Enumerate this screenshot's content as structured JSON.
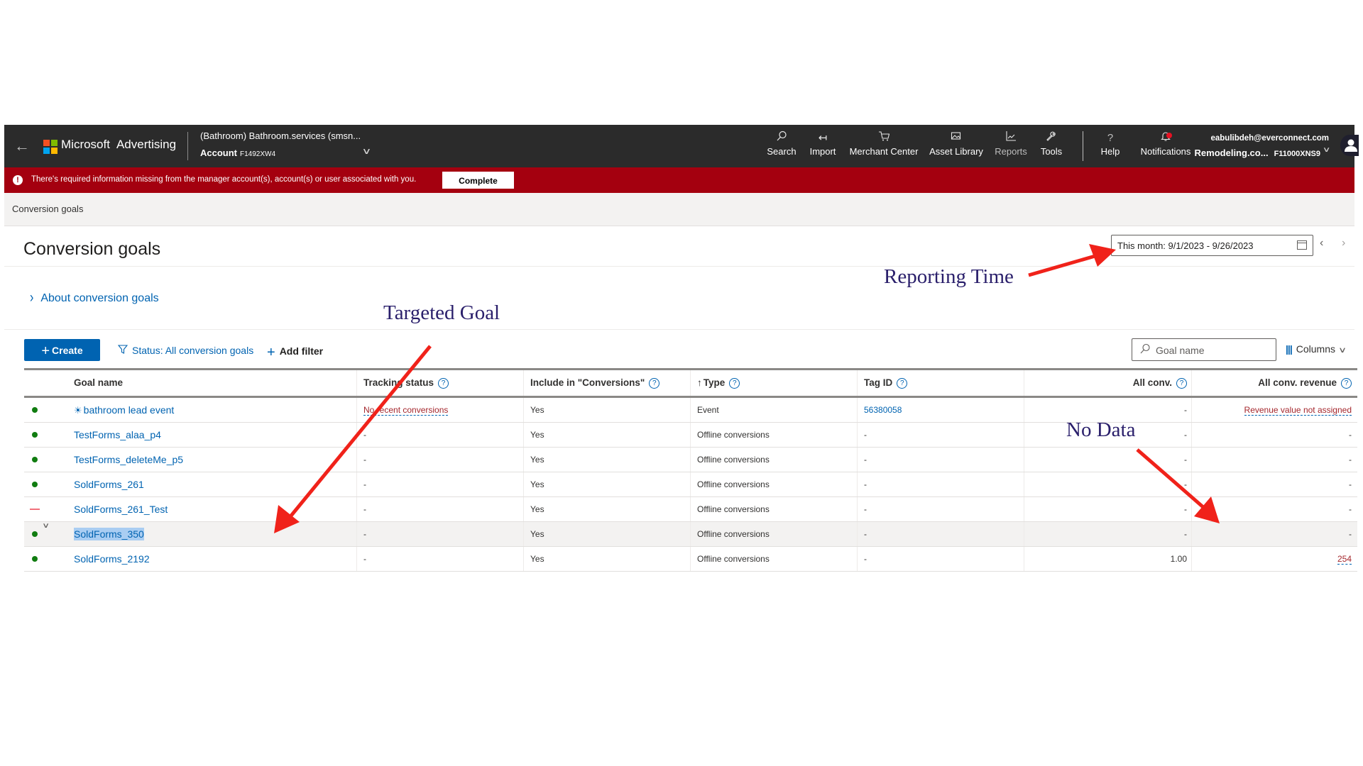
{
  "topbar": {
    "brand_name": "Microsoft",
    "brand_product": "Advertising",
    "account_name": "(Bathroom) Bathroom.services (smsn...",
    "account_label": "Account",
    "account_id": "F1492XW4",
    "nav": [
      {
        "label": "Search",
        "icon": "search-icon"
      },
      {
        "label": "Import",
        "icon": "import-icon"
      },
      {
        "label": "Merchant Center",
        "icon": "cart-icon"
      },
      {
        "label": "Asset Library",
        "icon": "asset-library-icon"
      },
      {
        "label": "Reports",
        "icon": "reports-icon"
      },
      {
        "label": "Tools",
        "icon": "wrench-icon"
      },
      {
        "label": "Help",
        "icon": "help-icon"
      },
      {
        "label": "Notifications",
        "icon": "bell-icon"
      }
    ],
    "user_email": "eabulibdeh@everconnect.com",
    "user_account": "Remodeling.co...",
    "user_account_id": "F11000XNS9"
  },
  "banner": {
    "message": "There's required information missing from the manager account(s), account(s) or user associated with you.",
    "button_label": "Complete",
    "color": "#a4000f"
  },
  "breadcrumb": "Conversion goals",
  "page": {
    "title": "Conversion goals",
    "date_range": "This month: 9/1/2023 - 9/26/2023",
    "about_link": "About conversion goals"
  },
  "toolbar": {
    "create_label": "Create",
    "status_filter": "Status: All conversion goals",
    "add_filter": "Add filter",
    "search_placeholder": "Goal name",
    "columns_label": "Columns"
  },
  "table": {
    "headers": [
      "Goal name",
      "Tracking status",
      "Include in \"Conversions\"",
      "Type",
      "Tag ID",
      "All conv.",
      "All conv. revenue"
    ],
    "rows": [
      {
        "status": "active",
        "name": "bathroom lead event",
        "tracking": "No recent conversions",
        "include": "Yes",
        "type": "Event",
        "tag_id": "56380058",
        "all_conv": "-",
        "revenue": "Revenue value not assigned"
      },
      {
        "status": "active",
        "name": "TestForms_alaa_p4",
        "tracking": "-",
        "include": "Yes",
        "type": "Offline conversions",
        "tag_id": "-",
        "all_conv": "-",
        "revenue": "-"
      },
      {
        "status": "active",
        "name": "TestForms_deleteMe_p5",
        "tracking": "-",
        "include": "Yes",
        "type": "Offline conversions",
        "tag_id": "-",
        "all_conv": "-",
        "revenue": "-"
      },
      {
        "status": "active",
        "name": "SoldForms_261",
        "tracking": "-",
        "include": "Yes",
        "type": "Offline conversions",
        "tag_id": "-",
        "all_conv": "-",
        "revenue": "-"
      },
      {
        "status": "paused",
        "name": "SoldForms_261_Test",
        "tracking": "-",
        "include": "Yes",
        "type": "Offline conversions",
        "tag_id": "-",
        "all_conv": "-",
        "revenue": "-"
      },
      {
        "status": "active",
        "name": "SoldForms_350",
        "tracking": "-",
        "include": "Yes",
        "type": "Offline conversions",
        "tag_id": "-",
        "all_conv": "-",
        "revenue": "-"
      },
      {
        "status": "active",
        "name": "SoldForms_2192",
        "tracking": "-",
        "include": "Yes",
        "type": "Offline conversions",
        "tag_id": "-",
        "all_conv": "1.00",
        "revenue": "254"
      }
    ]
  },
  "annotations": {
    "reporting_time": "Reporting Time",
    "targeted_goal": "Targeted Goal",
    "no_data": "No Data",
    "arrow_color": "#f0221a"
  }
}
